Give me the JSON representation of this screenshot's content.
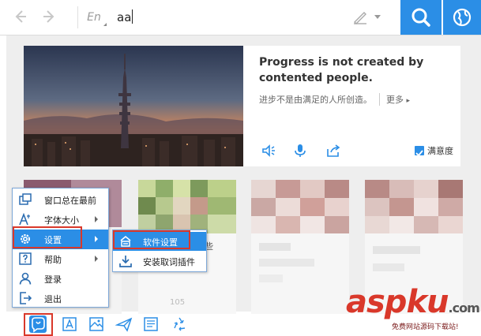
{
  "topbar": {
    "back_icon": "chevron-left-icon",
    "forward_icon": "chevron-right-icon",
    "language_label": "En",
    "search_value": "aa",
    "handwrite_icon": "handwrite-pen-icon",
    "search_icon": "search-icon",
    "globe_icon": "globe-icon",
    "accent_color": "#2b8ee6"
  },
  "daily": {
    "quote_en": "Progress is not created by contented people.",
    "quote_cn": "进步不是由满足的人所创造。",
    "more_label": "更多",
    "speaker_icon": "speaker-icon",
    "mic_icon": "microphone-icon",
    "share_icon": "share-icon",
    "satisfaction_label": "满意度",
    "satisfaction_checked": true
  },
  "thumb_texts": {
    "second_caption": "些",
    "likes_count": "105"
  },
  "menu": {
    "items": [
      {
        "label": "窗口总在最前",
        "icon": "window-pin-icon",
        "submenu": false
      },
      {
        "label": "字体大小",
        "icon": "font-size-icon",
        "submenu": true
      },
      {
        "label": "设置",
        "icon": "gear-icon",
        "submenu": true
      },
      {
        "label": "帮助",
        "icon": "help-icon",
        "submenu": true
      },
      {
        "label": "登录",
        "icon": "user-icon",
        "submenu": false
      },
      {
        "label": "退出",
        "icon": "exit-icon",
        "submenu": false
      }
    ],
    "highlight_color": "#d9382a"
  },
  "submenu": {
    "items": [
      {
        "label": "软件设置",
        "icon": "software-settings-icon"
      },
      {
        "label": "安装取词插件",
        "icon": "download-icon"
      }
    ]
  },
  "toolbar": {
    "icons": [
      "app-logo-icon",
      "word-card-icon",
      "image-translate-icon",
      "paper-plane-icon",
      "translate-doc-icon",
      "recycle-icon"
    ]
  },
  "watermark": {
    "text_a": "asp",
    "text_b": "ku",
    "text_c": ".com",
    "sub": "免费网站源码下载站!"
  }
}
